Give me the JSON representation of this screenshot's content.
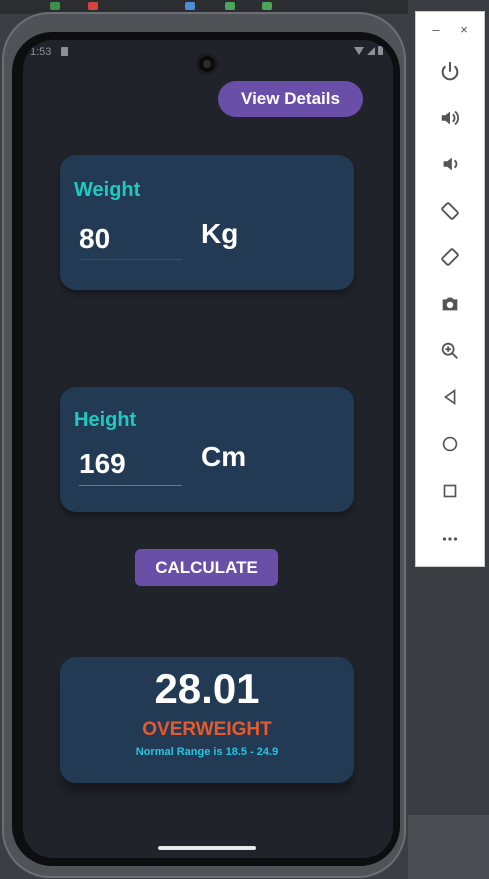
{
  "status_bar": {
    "time": "1:53"
  },
  "header": {
    "view_details_label": "View Details"
  },
  "weight": {
    "label": "Weight",
    "value": "80",
    "unit": "Kg"
  },
  "height": {
    "label": "Height",
    "value": "169",
    "unit": "Cm"
  },
  "calculate_label": "CALCULATE",
  "result": {
    "bmi": "28.01",
    "status": "OVERWEIGHT",
    "range_text": "Normal Range is 18.5 - 24.9"
  },
  "emulator_toolbar": {
    "minimize": "–",
    "close": "×",
    "buttons": [
      "power-icon",
      "volume-up-icon",
      "volume-down-icon",
      "rotate-left-icon",
      "rotate-right-icon",
      "camera-icon",
      "zoom-icon",
      "back-icon",
      "home-icon",
      "overview-icon",
      "more-icon"
    ]
  },
  "colors": {
    "accent_purple": "#6a4fa8",
    "card_bg": "#233a55",
    "label_teal": "#20c9c0",
    "status_orange": "#e85a2a",
    "range_cyan": "#27c4e0",
    "screen_bg": "#20232a"
  }
}
